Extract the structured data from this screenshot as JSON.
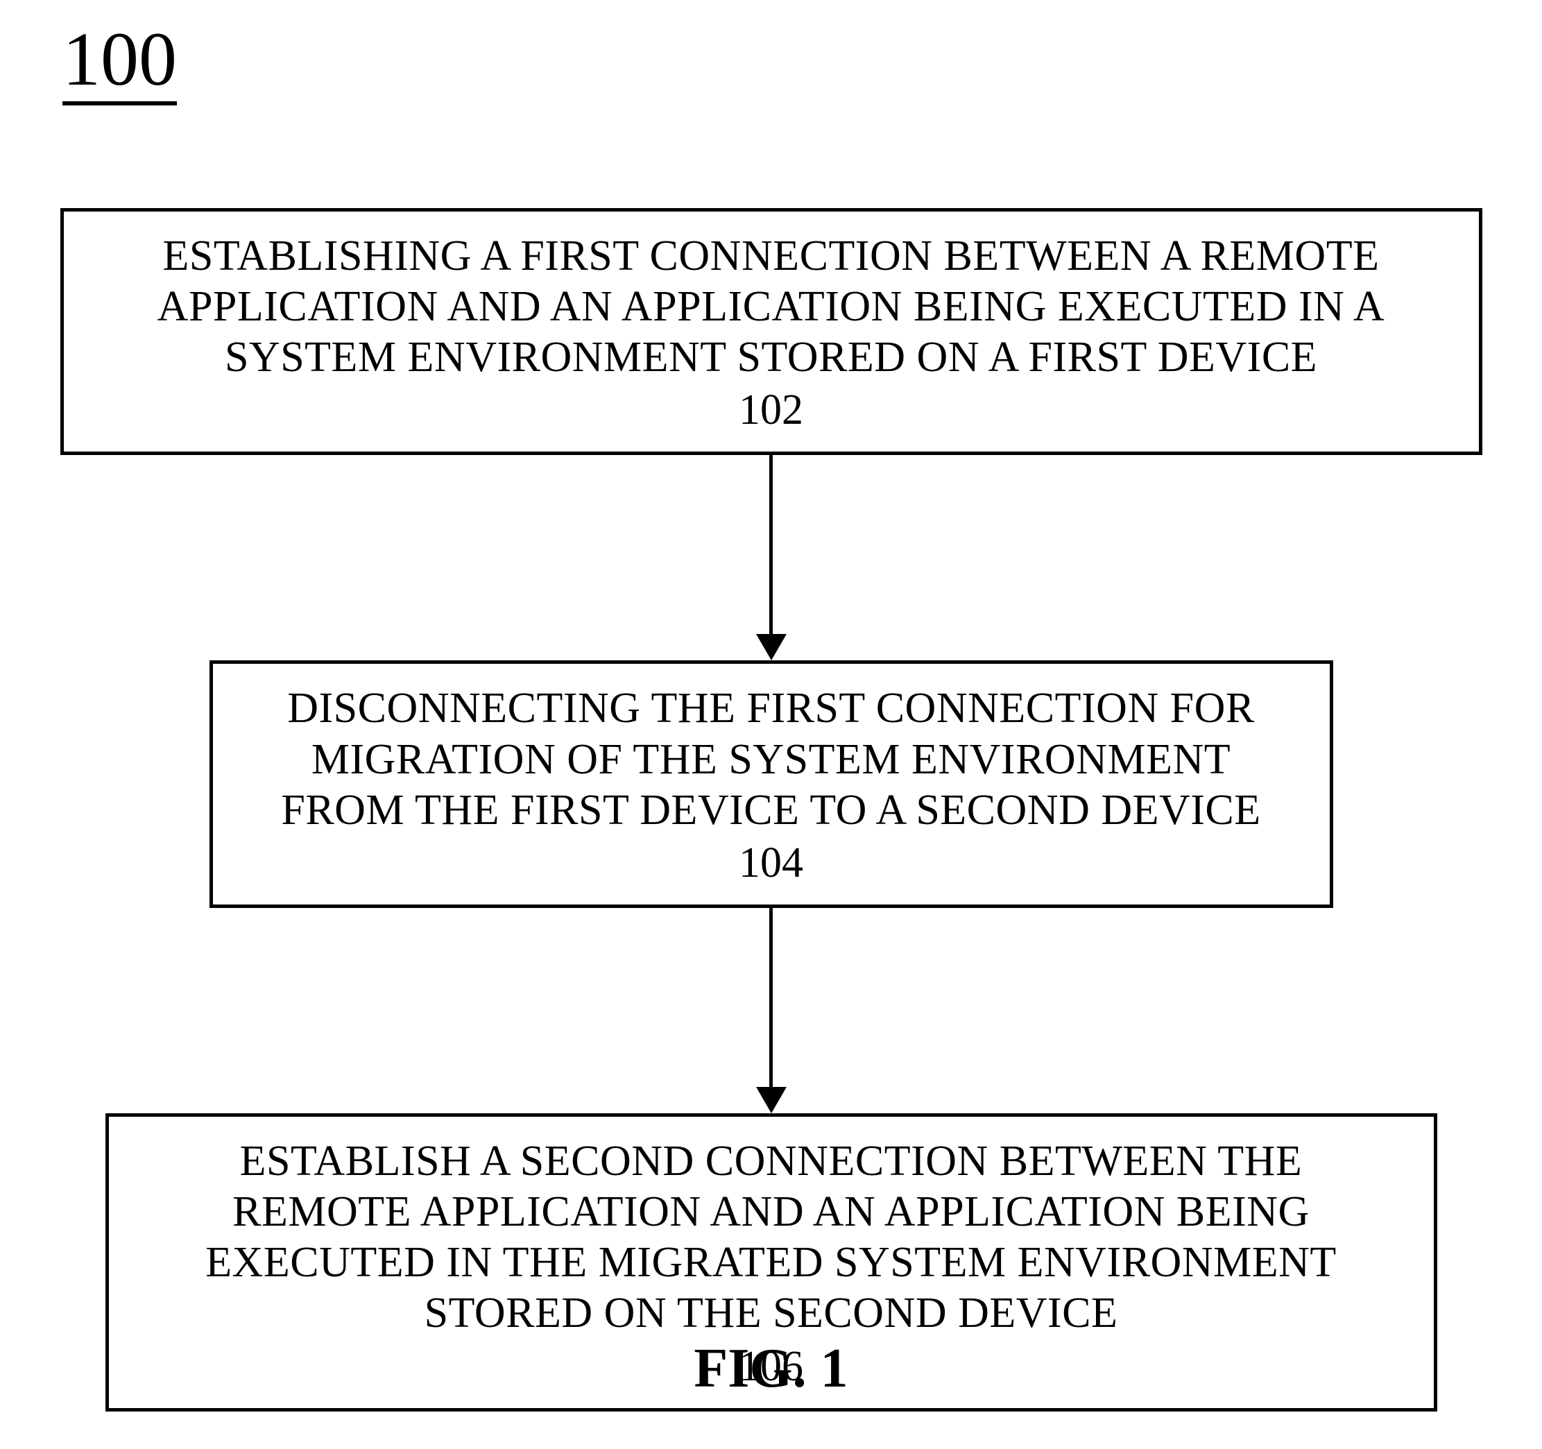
{
  "figure_ref": "100",
  "figure_label": "FIG. 1",
  "boxes": {
    "b1": {
      "text": "ESTABLISHING A FIRST CONNECTION BETWEEN A REMOTE\nAPPLICATION AND AN APPLICATION BEING EXECUTED IN A\nSYSTEM ENVIRONMENT STORED ON A FIRST DEVICE",
      "num": "102"
    },
    "b2": {
      "text": "DISCONNECTING THE FIRST CONNECTION FOR\nMIGRATION OF THE SYSTEM ENVIRONMENT\nFROM THE FIRST DEVICE TO A SECOND DEVICE",
      "num": "104"
    },
    "b3": {
      "text": "ESTABLISH A SECOND CONNECTION BETWEEN THE\nREMOTE APPLICATION AND AN APPLICATION BEING\nEXECUTED IN THE MIGRATED SYSTEM ENVIRONMENT\nSTORED ON THE SECOND DEVICE",
      "num": "106"
    }
  }
}
